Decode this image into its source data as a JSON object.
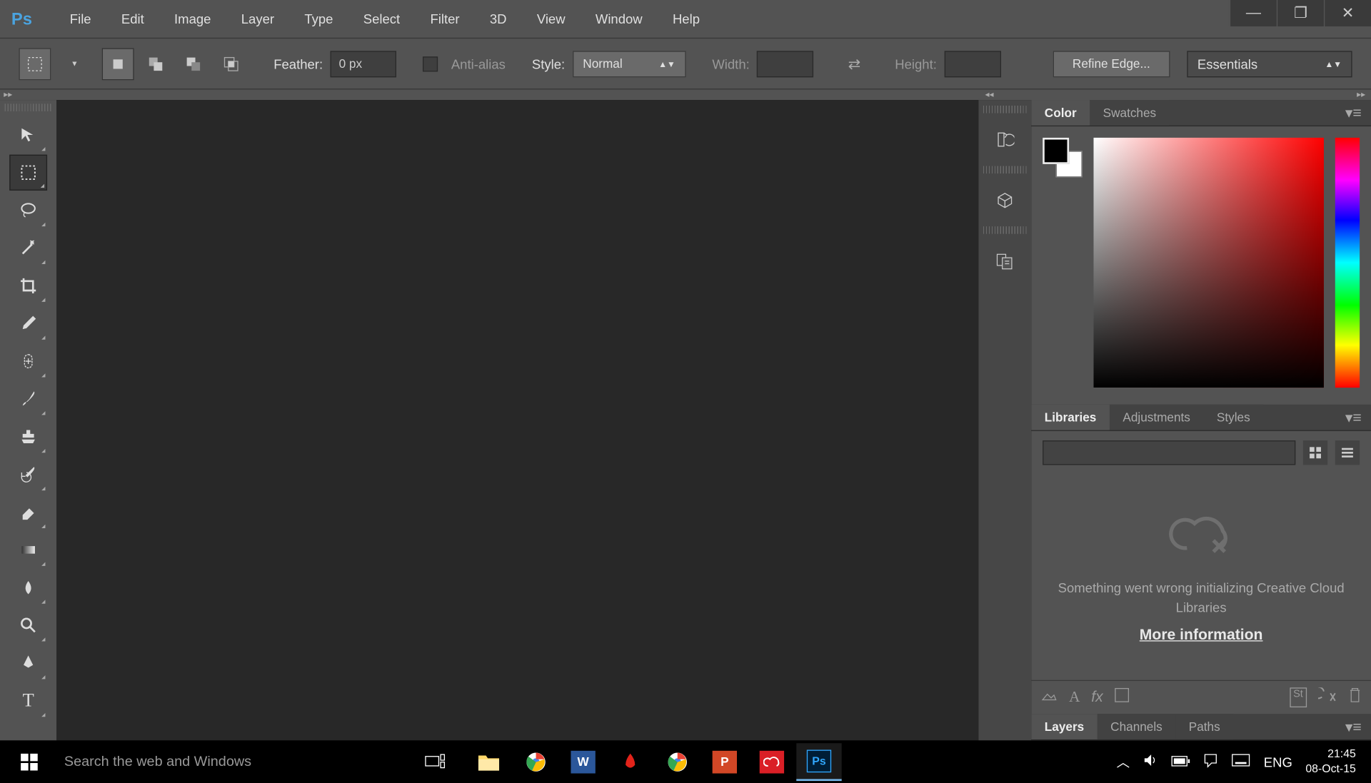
{
  "menu": {
    "items": [
      "File",
      "Edit",
      "Image",
      "Layer",
      "Type",
      "Select",
      "Filter",
      "3D",
      "View",
      "Window",
      "Help"
    ]
  },
  "options": {
    "feather_label": "Feather:",
    "feather_value": "0 px",
    "antialias_label": "Anti-alias",
    "style_label": "Style:",
    "style_value": "Normal",
    "width_label": "Width:",
    "height_label": "Height:",
    "refine": "Refine Edge...",
    "workspace": "Essentials"
  },
  "panels": {
    "color_tabs": [
      "Color",
      "Swatches"
    ],
    "lib_tabs": [
      "Libraries",
      "Adjustments",
      "Styles"
    ],
    "lib_error": "Something went wrong initializing Creative Cloud Libraries",
    "lib_link": "More information",
    "layers_tabs": [
      "Layers",
      "Channels",
      "Paths"
    ]
  },
  "taskbar": {
    "search_placeholder": "Search the web and Windows",
    "lang": "ENG",
    "time": "21:45",
    "date": "08-Oct-15"
  },
  "tools": [
    "move",
    "marquee",
    "lasso",
    "wand",
    "crop",
    "eyedropper",
    "healing",
    "brush",
    "stamp",
    "history-brush",
    "eraser",
    "gradient",
    "blur",
    "zoom",
    "pen",
    "type"
  ]
}
